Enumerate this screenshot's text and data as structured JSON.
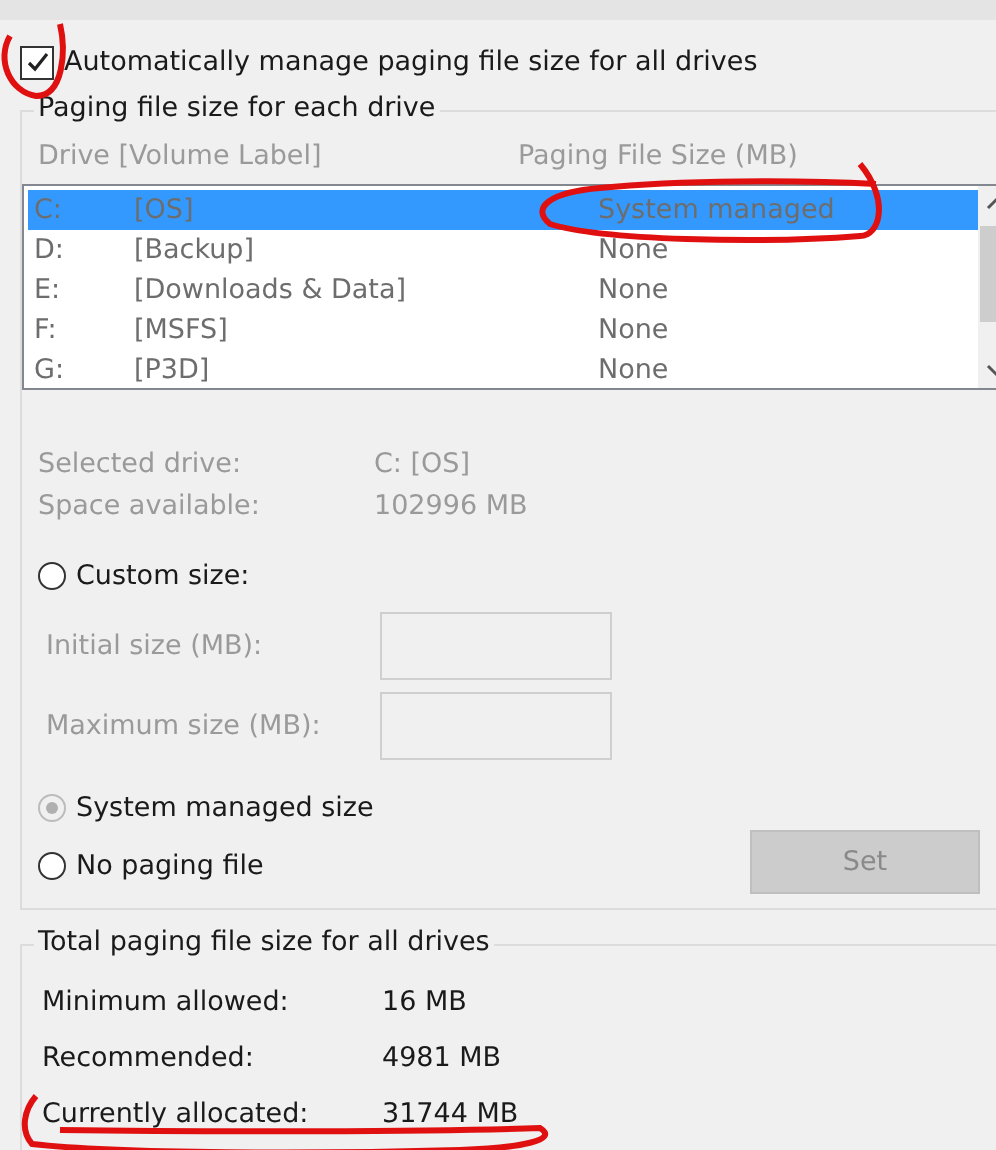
{
  "auto_manage": {
    "label": "Automatically manage paging file size for all drives",
    "checked": true
  },
  "drive_group": {
    "title": "Paging file size for each drive",
    "columns": [
      "Drive  [Volume Label]",
      "Paging File Size (MB)"
    ],
    "drives": [
      {
        "drive": "C:",
        "label": "[OS]",
        "size": "System managed",
        "selected": true
      },
      {
        "drive": "D:",
        "label": "[Backup]",
        "size": "None",
        "selected": false
      },
      {
        "drive": "E:",
        "label": "[Downloads & Data]",
        "size": "None",
        "selected": false
      },
      {
        "drive": "F:",
        "label": "[MSFS]",
        "size": "None",
        "selected": false
      },
      {
        "drive": "G:",
        "label": "[P3D]",
        "size": "None",
        "selected": false
      }
    ],
    "info": [
      {
        "label": "Selected drive:",
        "value": "C:  [OS]"
      },
      {
        "label": "Space available:",
        "value": "102996 MB"
      }
    ],
    "custom": {
      "label": "Custom size:",
      "selected": false
    },
    "fields": [
      {
        "label": "Initial size (MB):"
      },
      {
        "label": "Maximum size (MB):"
      }
    ],
    "system_managed": {
      "label": "System managed size",
      "selected": true
    },
    "no_paging": {
      "label": "No paging file",
      "selected": false
    },
    "set_button": {
      "label": "Set"
    }
  },
  "totals_group": {
    "title": "Total paging file size for all drives",
    "rows": [
      {
        "label": "Minimum allowed:",
        "value": "16 MB"
      },
      {
        "label": "Recommended:",
        "value": "4981 MB"
      },
      {
        "label": "Currently allocated:",
        "value": "31744 MB"
      }
    ]
  }
}
